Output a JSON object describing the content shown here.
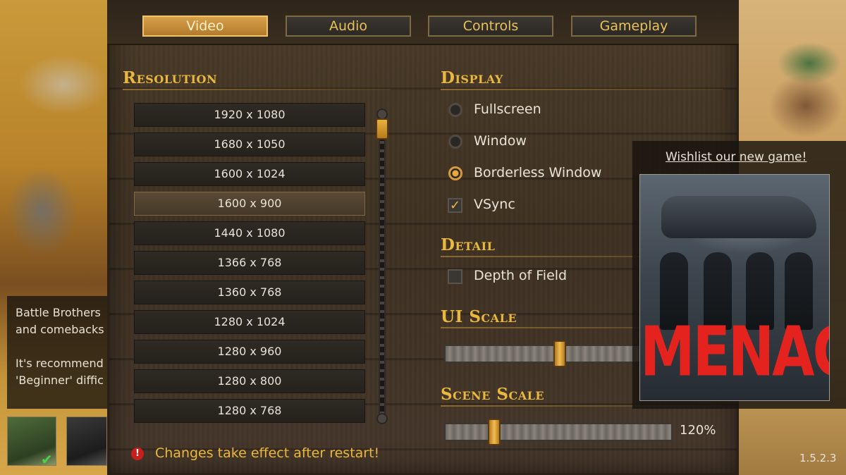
{
  "tabs": [
    {
      "label": "Video",
      "active": true
    },
    {
      "label": "Audio",
      "active": false
    },
    {
      "label": "Controls",
      "active": false
    },
    {
      "label": "Gameplay",
      "active": false
    }
  ],
  "resolution": {
    "title": "Resolution",
    "items": [
      "1920 x 1080",
      "1680 x 1050",
      "1600 x 1024",
      "1600 x 900",
      "1440 x 1080",
      "1366 x 768",
      "1360 x 768",
      "1280 x 1024",
      "1280 x 960",
      "1280 x 800",
      "1280 x 768"
    ],
    "selected": "1600 x 900"
  },
  "display": {
    "title": "Display",
    "options": [
      {
        "label": "Fullscreen",
        "selected": false
      },
      {
        "label": "Window",
        "selected": false
      },
      {
        "label": "Borderless Window",
        "selected": true
      }
    ],
    "vsync": {
      "label": "VSync",
      "checked": true
    }
  },
  "detail": {
    "title": "Detail",
    "depth_of_field": {
      "label": "Depth of Field",
      "checked": false
    }
  },
  "ui_scale": {
    "title": "UI Scale"
  },
  "scene_scale": {
    "title": "Scene Scale",
    "value": "120%"
  },
  "warning": "Changes take effect after restart!",
  "tip": "Battle Brothers\nand comebacks\n\nIt's recommend\n'Beginner' diffic",
  "ad": {
    "link": "Wishlist our new game!",
    "game_title": "MENACE"
  },
  "version": "1.5.2.3",
  "colors": {
    "accent": "#e9b83c",
    "active_tab": "#d7a04a",
    "warning": "#c81e1e",
    "ad_title": "#e4231f"
  }
}
